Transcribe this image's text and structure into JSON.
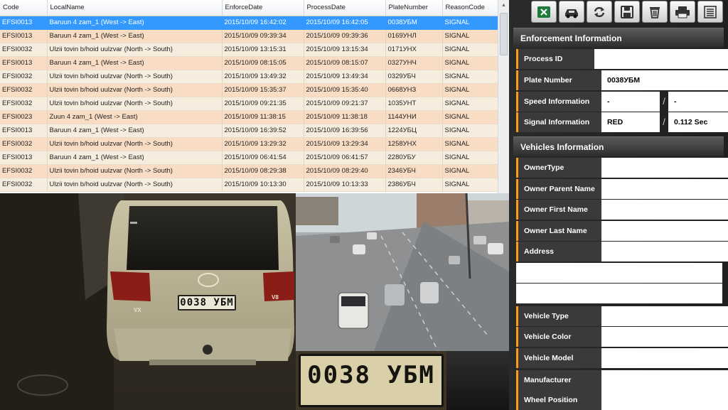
{
  "table": {
    "columns": [
      "Code",
      "LocalName",
      "EnforceDate",
      "ProcessDate",
      "PlateNumber",
      "ReasonCode"
    ],
    "rows": [
      [
        "EFSI0013",
        "Baruun 4 zam_1 (West -> East)",
        "2015/10/09 16:42:02",
        "2015/10/09 16:42:05",
        "0038УБМ",
        "SIGNAL"
      ],
      [
        "EFSI0013",
        "Baruun 4 zam_1 (West -> East)",
        "2015/10/09 09:39:34",
        "2015/10/09 09:39:36",
        "0169УНЛ",
        "SIGNAL"
      ],
      [
        "EFSI0032",
        "Ulzii tovin b/hoid uulzvar (North -> South)",
        "2015/10/09 13:15:31",
        "2015/10/09 13:15:34",
        "0171УНХ",
        "SIGNAL"
      ],
      [
        "EFSI0013",
        "Baruun 4 zam_1 (West -> East)",
        "2015/10/09 08:15:05",
        "2015/10/09 08:15:07",
        "0327УНЧ",
        "SIGNAL"
      ],
      [
        "EFSI0032",
        "Ulzii tovin b/hoid uulzvar (North -> South)",
        "2015/10/09 13:49:32",
        "2015/10/09 13:49:34",
        "0329УБЧ",
        "SIGNAL"
      ],
      [
        "EFSI0032",
        "Ulzii tovin b/hoid uulzvar (North -> South)",
        "2015/10/09 15:35:37",
        "2015/10/09 15:35:40",
        "0668УНЗ",
        "SIGNAL"
      ],
      [
        "EFSI0032",
        "Ulzii tovin b/hoid uulzvar (North -> South)",
        "2015/10/09 09:21:35",
        "2015/10/09 09:21:37",
        "1035УНТ",
        "SIGNAL"
      ],
      [
        "EFSI0023",
        "Zuun 4 zam_1 (West -> East)",
        "2015/10/09 11:38:15",
        "2015/10/09 11:38:18",
        "1144УНИ",
        "SIGNAL"
      ],
      [
        "EFSI0013",
        "Baruun 4 zam_1 (West -> East)",
        "2015/10/09 16:39:52",
        "2015/10/09 16:39:56",
        "1224УБЦ",
        "SIGNAL"
      ],
      [
        "EFSI0032",
        "Ulzii tovin b/hoid uulzvar (North -> South)",
        "2015/10/09 13:29:32",
        "2015/10/09 13:29:34",
        "1258УНХ",
        "SIGNAL"
      ],
      [
        "EFSI0013",
        "Baruun 4 zam_1 (West -> East)",
        "2015/10/09 06:41:54",
        "2015/10/09 06:41:57",
        "2280УБУ",
        "SIGNAL"
      ],
      [
        "EFSI0032",
        "Ulzii tovin b/hoid uulzvar (North -> South)",
        "2015/10/09 08:29:38",
        "2015/10/09 08:29:40",
        "2346УБЧ",
        "SIGNAL"
      ],
      [
        "EFSI0032",
        "Ulzii tovin b/hoid uulzvar (North -> South)",
        "2015/10/09 10:13:30",
        "2015/10/09 10:13:33",
        "2386УБЧ",
        "SIGNAL"
      ]
    ],
    "selected_row": 0
  },
  "images": {
    "car_plate_text": "0038 УБМ",
    "crop_plate_text": "0038 УБМ",
    "car_badge_left": "VX",
    "car_badge_right": "V8"
  },
  "toolbar": {
    "icons": [
      "excel-icon",
      "car-icon",
      "refresh-icon",
      "save-icon",
      "trash-icon",
      "printer-icon",
      "list-icon"
    ]
  },
  "enforcement": {
    "title": "Enforcement Information",
    "process_id_label": "Process ID",
    "process_id": "",
    "plate_label": "Plate Number",
    "plate": "0038УБМ",
    "speed_label": "Speed Information",
    "speed_value": "-",
    "speed_limit": "-",
    "signal_label": "Signal Information",
    "signal_value": "RED",
    "signal_time": "0.112 Sec"
  },
  "vehicles": {
    "title": "Vehicles Information",
    "owner_type_label": "OwnerType",
    "owner_type": "",
    "owner_parent_label": "Owner Parent Name",
    "owner_parent": "",
    "owner_first_label": "Owner First Name",
    "owner_first": "",
    "owner_last_label": "Owner Last Name",
    "owner_last": "",
    "address_label": "Address",
    "address": "",
    "type_label": "Vehicle Type",
    "type": "",
    "color_label": "Vehicle Color",
    "color": "",
    "model_label": "Vehicle Model",
    "model": "",
    "manufacturer_label": "Manufacturer",
    "manufacturer": "",
    "wheel_label": "Wheel Position",
    "wheel": ""
  },
  "colors": {
    "selection": "#3399ff",
    "row_a": "#f6edde",
    "row_b": "#f9dcc4",
    "label_accent": "#ff9a1a"
  }
}
